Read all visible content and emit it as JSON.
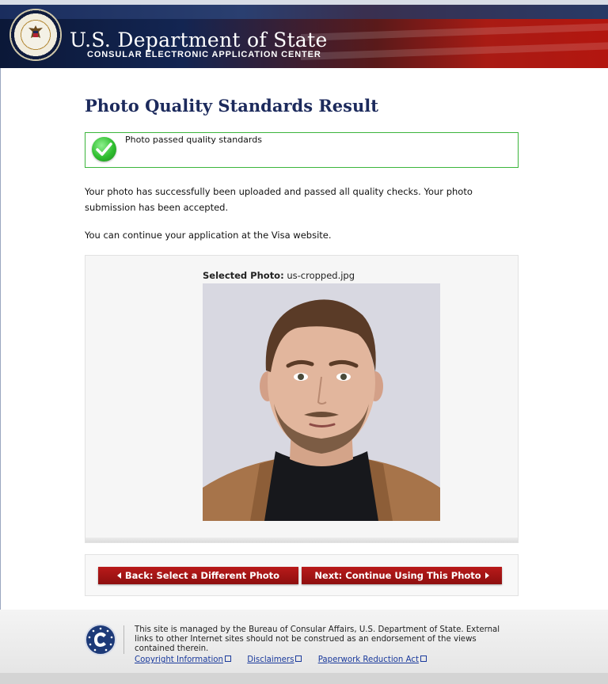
{
  "header": {
    "title": "U.S. Department of State",
    "subtitle": "CONSULAR ELECTRONIC APPLICATION CENTER",
    "seal_icon": "state-department-seal-icon"
  },
  "main": {
    "page_title": "Photo Quality Standards Result",
    "status": {
      "message": "Photo passed quality standards",
      "icon": "checkmark-success-icon",
      "color": "#3bb53b"
    },
    "paragraph1": "Your photo has successfully been uploaded and passed all quality checks. Your photo submission has been accepted.",
    "paragraph2": "You can continue your application at the Visa website.",
    "photo": {
      "label": "Selected Photo:",
      "filename": "us-cropped.jpg"
    }
  },
  "buttons": {
    "back_label": "Back: Select a Different Photo",
    "next_label": "Next: Continue Using This Photo",
    "color": "#a51414"
  },
  "footer": {
    "text": "This site is managed by the Bureau of Consular Affairs, U.S. Department of State. External links to other Internet sites should not be construed as an endorsement of the views contained therein.",
    "links": [
      "Copyright Information",
      "Disclaimers",
      "Paperwork Reduction Act"
    ],
    "logo_icon": "consular-affairs-logo-icon"
  }
}
